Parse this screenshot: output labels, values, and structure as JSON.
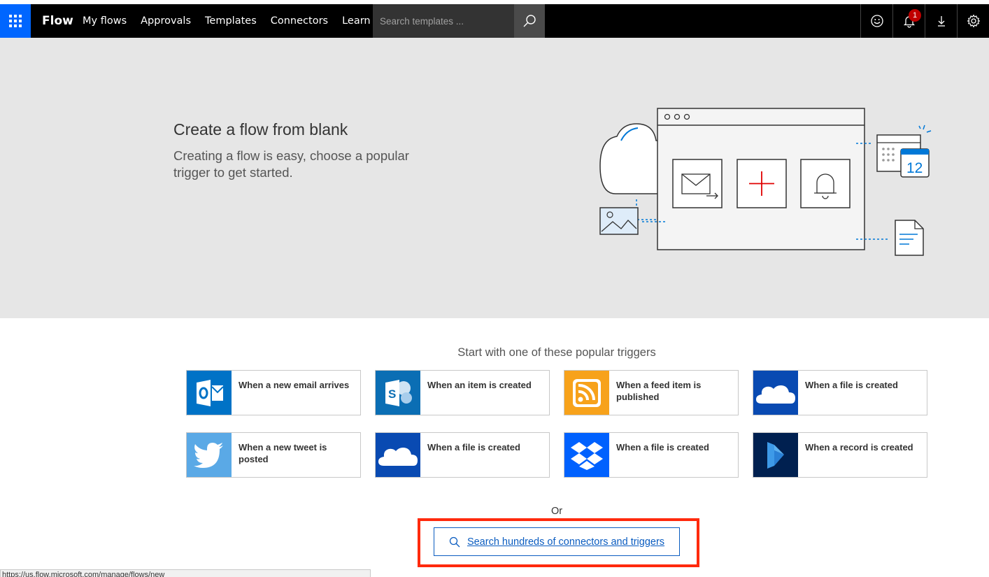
{
  "nav": {
    "brand": "Flow",
    "links": [
      "My flows",
      "Approvals",
      "Templates",
      "Connectors",
      "Learn"
    ],
    "search_placeholder": "Search templates ...",
    "notification_count": "1"
  },
  "hero": {
    "title": "Create a flow from blank",
    "subtitle": "Creating a flow is easy, choose a popular trigger to get started.",
    "calendar_day": "12"
  },
  "triggers": {
    "heading": "Start with one of these popular triggers",
    "items": [
      {
        "label": "When a new email arrives",
        "icon": "outlook-icon",
        "color": "#0072c6"
      },
      {
        "label": "When an item is created",
        "icon": "sharepoint-icon",
        "color": "#0b6eb4"
      },
      {
        "label": "When a feed item is published",
        "icon": "rss-icon",
        "color": "#f7a21b"
      },
      {
        "label": "When a file is created",
        "icon": "onedrive-business-icon",
        "color": "#094ab2"
      },
      {
        "label": "When a new tweet is posted",
        "icon": "twitter-icon",
        "color": "#5aa9e6"
      },
      {
        "label": "When a file is created",
        "icon": "onedrive-icon",
        "color": "#094ab2"
      },
      {
        "label": "When a file is created",
        "icon": "dropbox-icon",
        "color": "#0061fe"
      },
      {
        "label": "When a record is created",
        "icon": "dynamics-icon",
        "color": "#002050"
      }
    ]
  },
  "or_label": "Or",
  "search_connectors_label": "Search hundreds of connectors and triggers",
  "status_url": "https://us.flow.microsoft.com/manage/flows/new"
}
